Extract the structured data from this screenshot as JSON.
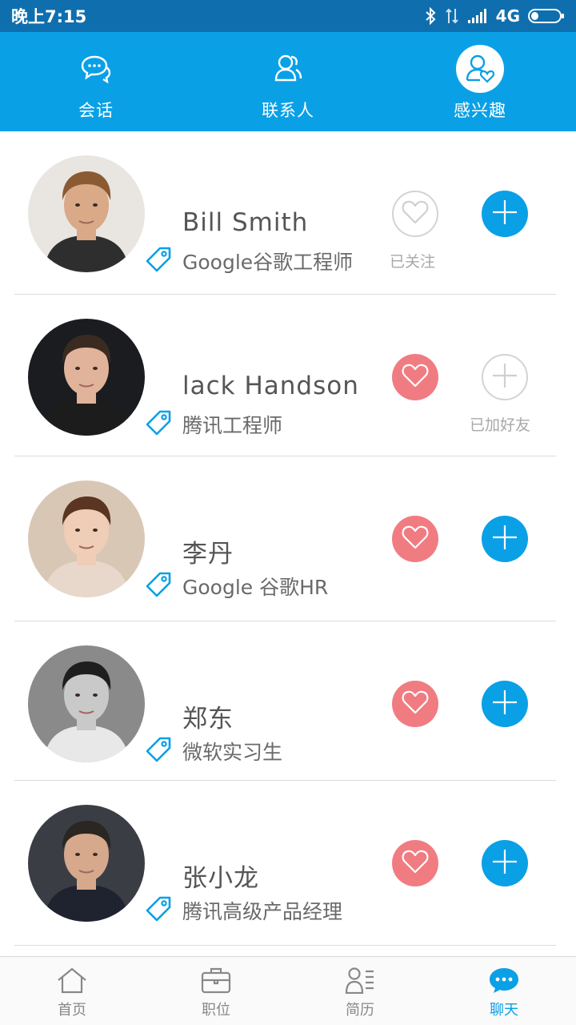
{
  "status_bar": {
    "time": "晚上7:15",
    "network": "4G"
  },
  "top_tabs": [
    {
      "label": "会话",
      "icon": "chat-bubbles-icon",
      "active": false
    },
    {
      "label": "联系人",
      "icon": "contacts-icon",
      "active": false
    },
    {
      "label": "感兴趣",
      "icon": "interested-person-icon",
      "active": true
    }
  ],
  "contacts": [
    {
      "name": "Bill Smith",
      "title": "Google谷歌工程师",
      "followed": false,
      "follow_caption": "已关注",
      "added": false,
      "add_caption": "",
      "avatar_skin": "#d9a988",
      "avatar_hair": "#8a5a32",
      "avatar_bg": "#e9e6e1",
      "avatar_shirt": "#2e2e2e"
    },
    {
      "name": "lack Handson",
      "title": "腾讯工程师",
      "followed": true,
      "follow_caption": "",
      "added": true,
      "add_caption": "已加好友",
      "avatar_skin": "#e0b39a",
      "avatar_hair": "#3a2a20",
      "avatar_bg": "#1a1c20",
      "avatar_shirt": "#1c1c1c"
    },
    {
      "name": "李丹",
      "title": "Google 谷歌HR",
      "followed": true,
      "follow_caption": "",
      "added": false,
      "add_caption": "",
      "avatar_skin": "#f0cdb6",
      "avatar_hair": "#5a3522",
      "avatar_bg": "#d9c7b6",
      "avatar_shirt": "#e8d8cc"
    },
    {
      "name": "郑东",
      "title": "微软实习生",
      "followed": true,
      "follow_caption": "",
      "added": false,
      "add_caption": "",
      "avatar_skin": "#c9c9c9",
      "avatar_hair": "#1e1e1e",
      "avatar_bg": "#8a8a8a",
      "avatar_shirt": "#e8e8e8"
    },
    {
      "name": "张小龙",
      "title": "腾讯高级产品经理",
      "followed": true,
      "follow_caption": "",
      "added": false,
      "add_caption": "",
      "avatar_skin": "#d6a88c",
      "avatar_hair": "#2a2622",
      "avatar_bg": "#3a3d44",
      "avatar_shirt": "#1f2330"
    }
  ],
  "bottom_nav": [
    {
      "label": "首页",
      "icon": "home-icon",
      "active": false
    },
    {
      "label": "职位",
      "icon": "briefcase-icon",
      "active": false
    },
    {
      "label": "简历",
      "icon": "resume-icon",
      "active": false
    },
    {
      "label": "聊天",
      "icon": "chat-icon",
      "active": true
    }
  ],
  "colors": {
    "primary": "#0aa0e6",
    "status_bar": "#0f6fae",
    "heart_active": "#f07c82",
    "divider": "#dcdcdc"
  }
}
